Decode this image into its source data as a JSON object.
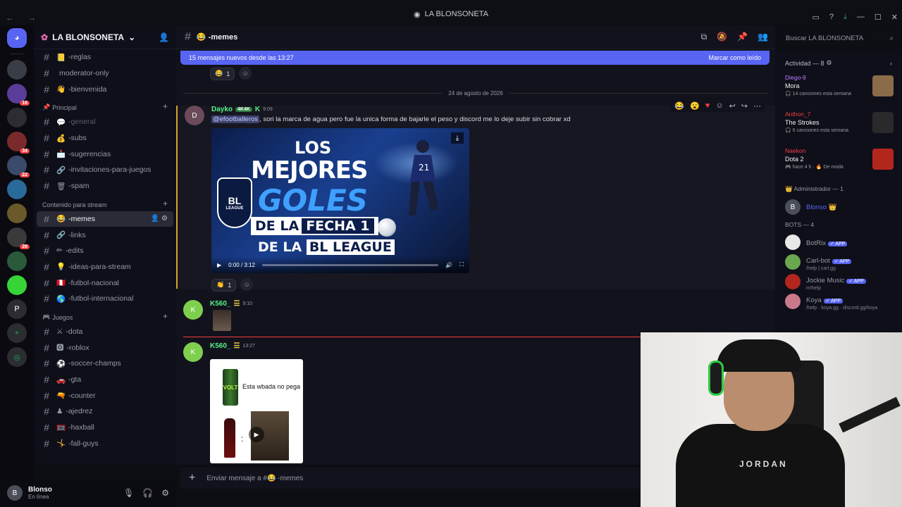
{
  "window": {
    "title": "LA BLONSONETA"
  },
  "rail": {
    "servers": [
      {
        "label": "",
        "badge": ""
      },
      {
        "label": "",
        "badge": "16"
      },
      {
        "label": "",
        "badge": ""
      },
      {
        "label": "",
        "badge": "34"
      },
      {
        "label": "",
        "badge": "22"
      },
      {
        "label": "",
        "badge": ""
      },
      {
        "label": "",
        "badge": ""
      },
      {
        "label": "",
        "badge": "26"
      },
      {
        "label": "",
        "badge": ""
      },
      {
        "label": "",
        "badge": ""
      },
      {
        "label": "P",
        "badge": ""
      }
    ]
  },
  "guild": {
    "name": "LA BLONSONETA"
  },
  "channels_top": [
    {
      "emoji": "📒",
      "name": "-reglas"
    },
    {
      "emoji": "",
      "name": "moderator-only"
    },
    {
      "emoji": "👋",
      "name": "-bienvenida"
    }
  ],
  "categories": {
    "principal": "Principal",
    "contenido": "Contenido para stream",
    "juegos": "Juegos"
  },
  "channels_principal": [
    {
      "emoji": "💬",
      "name": "-general",
      "muted": true
    },
    {
      "emoji": "💰",
      "name": "-subs"
    },
    {
      "emoji": "📩",
      "name": "-sugerencias"
    },
    {
      "emoji": "🔗",
      "name": "-invitaciones-para-juegos"
    },
    {
      "emoji": "🗑",
      "name": "-spam"
    }
  ],
  "channels_contenido": [
    {
      "emoji": "😂",
      "name": "-memes",
      "active": true
    },
    {
      "emoji": "🔗",
      "name": "-links"
    },
    {
      "emoji": "✏",
      "name": "-edits"
    },
    {
      "emoji": "💡",
      "name": "-ideas-para-stream"
    },
    {
      "emoji": "🇵🇪",
      "name": "-futbol-nacional"
    },
    {
      "emoji": "🌎",
      "name": "-futbol-internacional"
    }
  ],
  "channels_juegos": [
    {
      "emoji": "⚔",
      "name": "-dota"
    },
    {
      "emoji": "🅾",
      "name": "-roblox"
    },
    {
      "emoji": "⚽",
      "name": "-soccer-champs"
    },
    {
      "emoji": "🚗",
      "name": "-gta"
    },
    {
      "emoji": "🔫",
      "name": "-counter"
    },
    {
      "emoji": "♟",
      "name": "-ajedrez"
    },
    {
      "emoji": "🥅",
      "name": "-haxball"
    },
    {
      "emoji": "🤸",
      "name": "-fall-guys"
    }
  ],
  "user": {
    "name": "Blonso",
    "status": "En línea"
  },
  "header": {
    "channel": "😂 -memes"
  },
  "search": {
    "placeholder": "Buscar LA BLONSONETA"
  },
  "banner": {
    "text": "15 mensajes nuevos desde las 13:27",
    "action": "Marcar como leído"
  },
  "date_separator": "24 de agosto de 2026",
  "messages": [
    {
      "author": "Dayko",
      "tag": "4K4K",
      "time": "9:09",
      "author_color": "#57f287",
      "mention": "@efootballeros",
      "text": ", sori la marca de agua pero fue la unica forma de bajarle el peso y discord me lo deje subir sin cobrar xd",
      "video": {
        "time": "0:00 / 3:12",
        "line1": "LOS",
        "line2": "MEJORES",
        "line3": "GOLES",
        "line4": "DE LA",
        "line5": "FECHA 1",
        "line6": "DE LA",
        "line7": "BL LEAGUE",
        "logo": "BL",
        "logo_sub": "LEAGUE"
      },
      "reaction_count": "1"
    },
    {
      "author": "K560_",
      "time": "9:10",
      "author_color": "#57f287"
    },
    {
      "author": "K560_",
      "time": "13:27",
      "author_color": "#57f287",
      "meme_caption": "Esta wbada no pega",
      "meme_can": "VOLT"
    }
  ],
  "top_reaction_count": "1",
  "composer": {
    "placeholder": "Enviar mensaje a #😂 -memes"
  },
  "right_panel": {
    "activity_title": "Actividad — 8",
    "activities": [
      {
        "who": "Diego-9",
        "who_color": "#c27cff",
        "what": "Mora",
        "sub": "🎧 14 canciones esta semana",
        "art": "#8a6b4a"
      },
      {
        "who": "Anthon_7",
        "who_color": "#f23f43",
        "what": "The Strokes",
        "sub": "🎧 6 canciones esta semana",
        "art": "#2a2a2a"
      },
      {
        "who": "Naekon",
        "who_color": "#f23f43",
        "what": "Dota 2",
        "sub": "🎮 hace 4 h · 🔥 De moda",
        "art": "#b3261e"
      }
    ],
    "admin_title": "👑 Administrador — 1",
    "admin": {
      "name": "Blonso 👑",
      "color": "#5865f2"
    },
    "bots_title": "BOTS — 4",
    "bots": [
      {
        "name": "BotRix",
        "sub": "",
        "badge": "✓ APP"
      },
      {
        "name": "Carl-bot",
        "sub": "/help | carl.gg",
        "badge": "✓ APP"
      },
      {
        "name": "Jockie Music",
        "sub": "m!help",
        "badge": "✓ APP"
      },
      {
        "name": "Koya",
        "sub": "/help · koya.gg · discord.gg/koya",
        "badge": "✓ APP"
      }
    ]
  }
}
